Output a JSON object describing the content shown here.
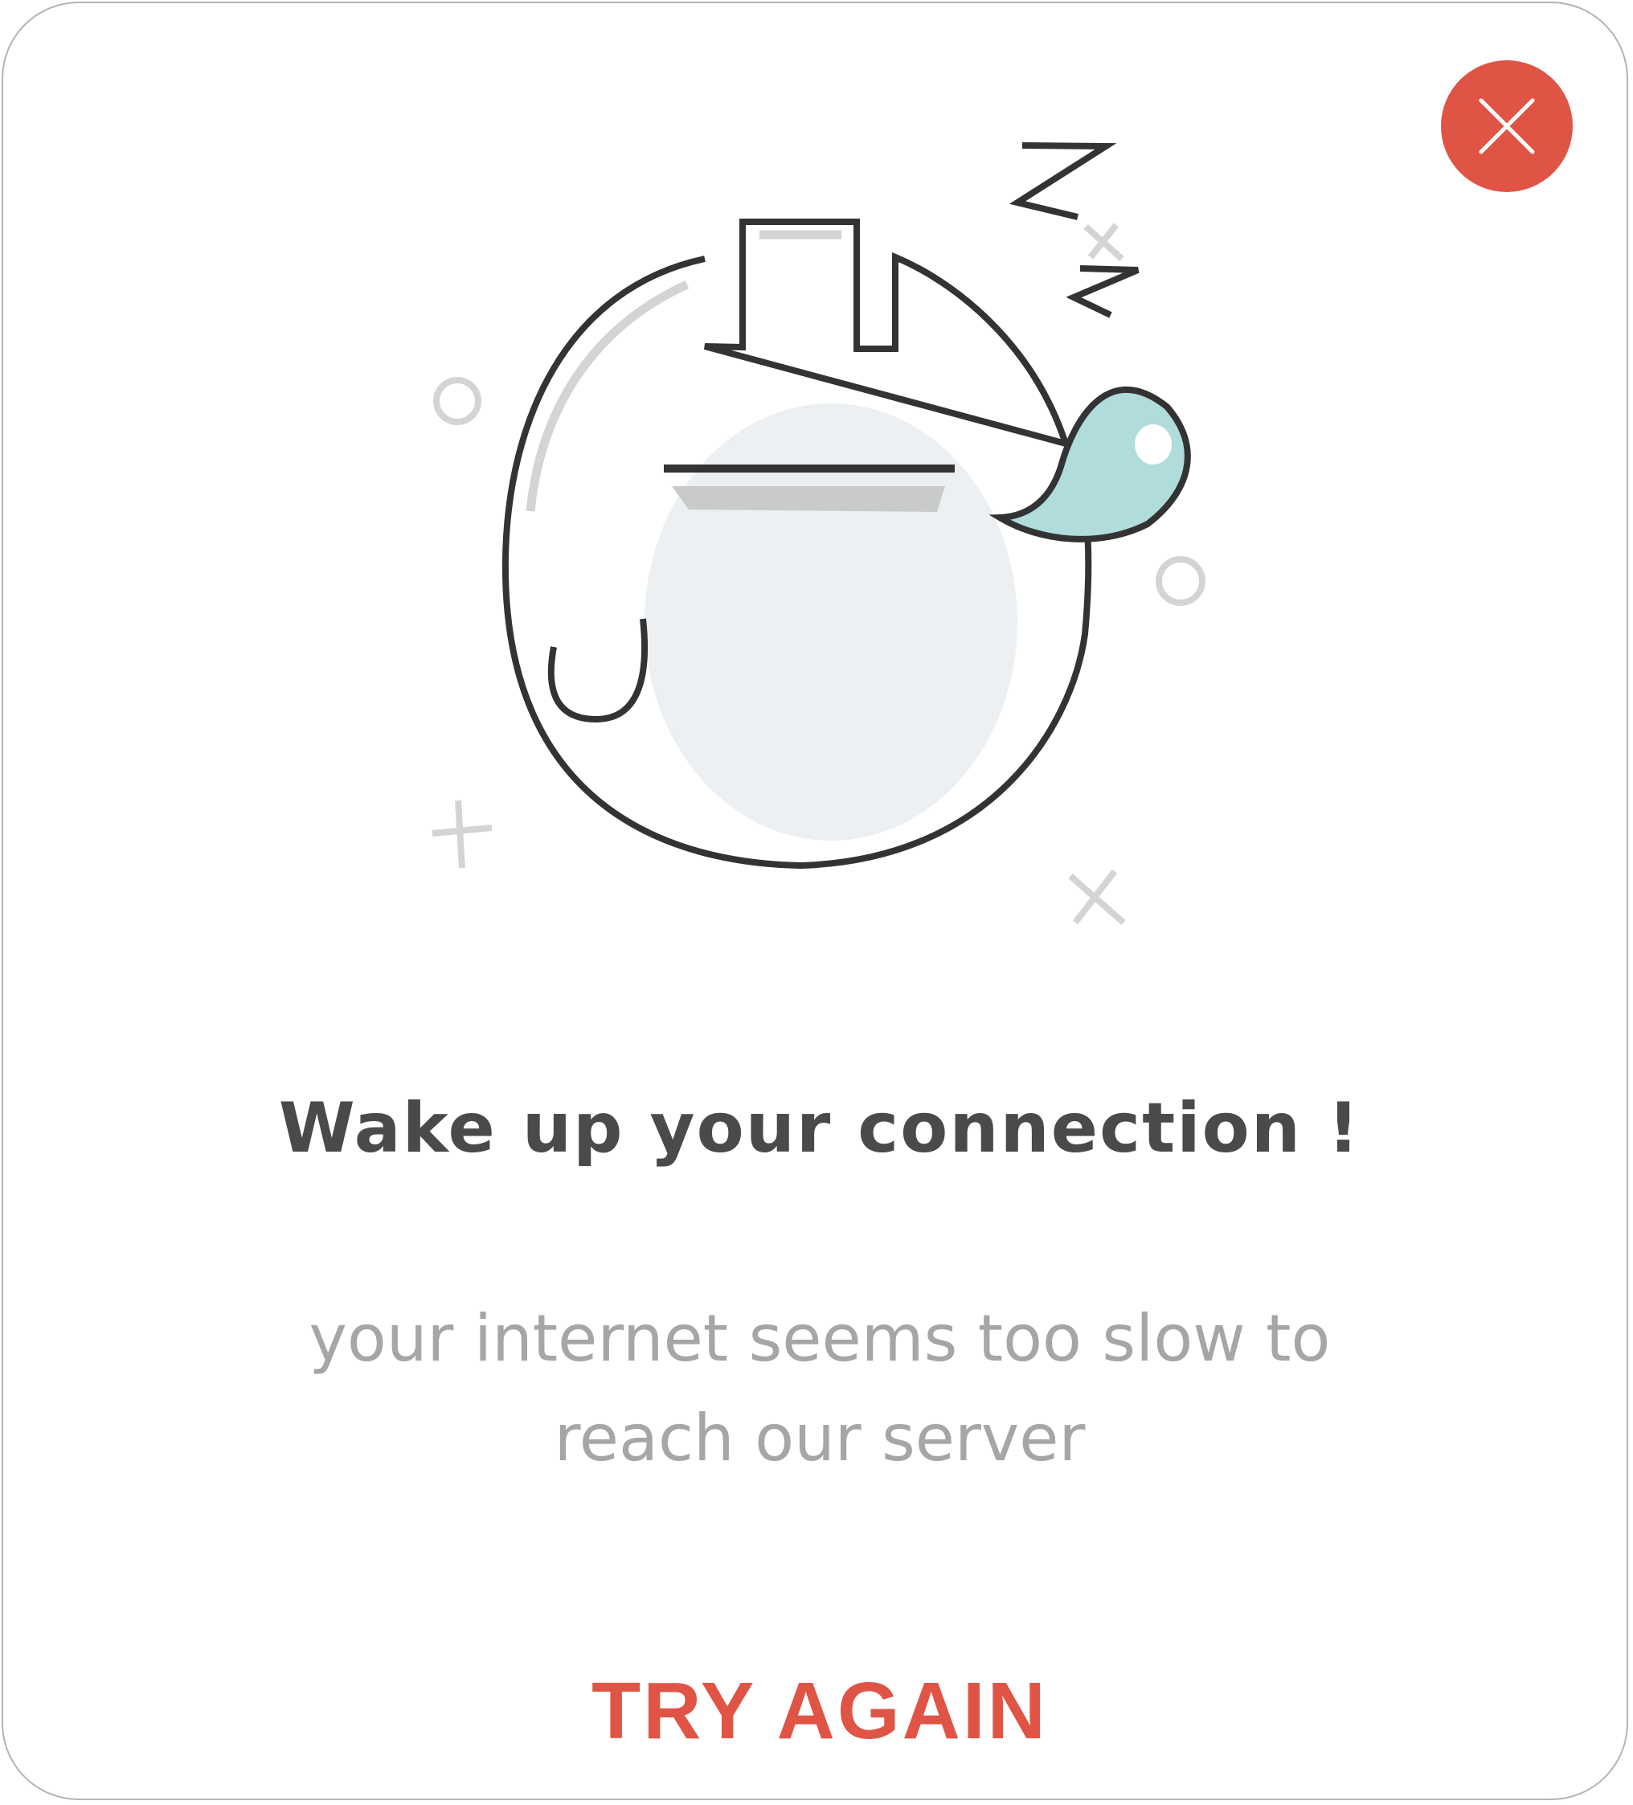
{
  "dialog": {
    "title": "Wake up your connection !",
    "message_line1": "your internet seems too slow to",
    "message_line2": "reach our server",
    "action_label": "TRY AGAIN",
    "close_icon": "close-icon",
    "illustration": "sleeping-plug-icon"
  },
  "colors": {
    "accent": "#e05445",
    "title": "#4a4a4a",
    "message": "#a6a6a6",
    "outline": "#333333",
    "bubble": "#b0dcdc"
  }
}
